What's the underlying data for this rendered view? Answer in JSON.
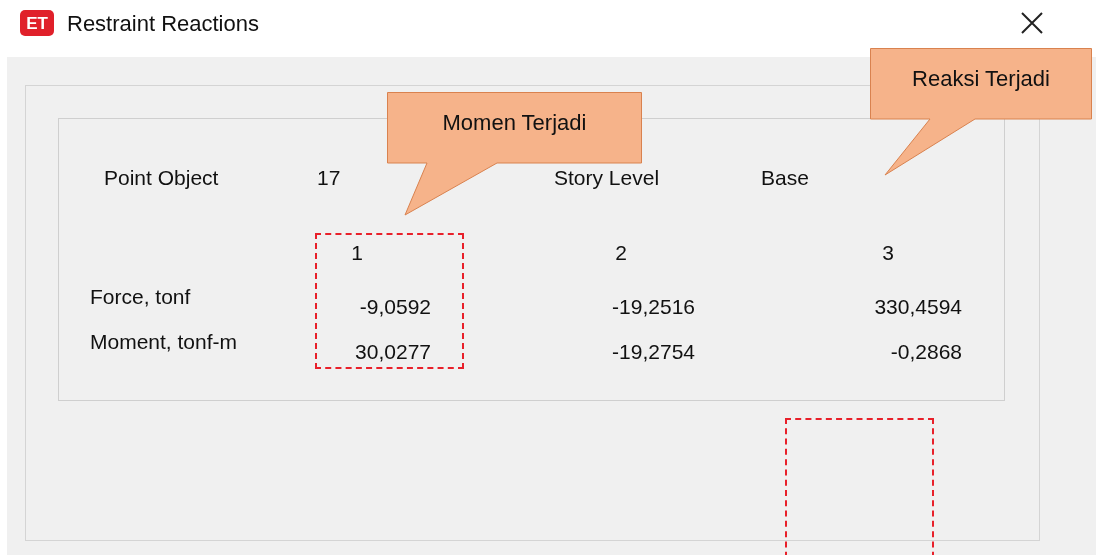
{
  "window": {
    "app_icon": "ET",
    "title": "Restraint Reactions"
  },
  "point": {
    "label": "Point Object",
    "value": "17",
    "level_label": "Story Level",
    "level_value": "Base"
  },
  "table": {
    "columns": [
      "1",
      "2",
      "3"
    ],
    "rows": [
      {
        "label": "Force, tonf",
        "values": [
          "-9,0592",
          "-19,2516",
          "330,4594"
        ]
      },
      {
        "label": "Moment, tonf-m",
        "values": [
          "30,0277",
          "-19,2754",
          "-0,2868"
        ]
      }
    ]
  },
  "callouts": [
    "Momen Terjadi",
    "Reaksi Terjadi"
  ]
}
